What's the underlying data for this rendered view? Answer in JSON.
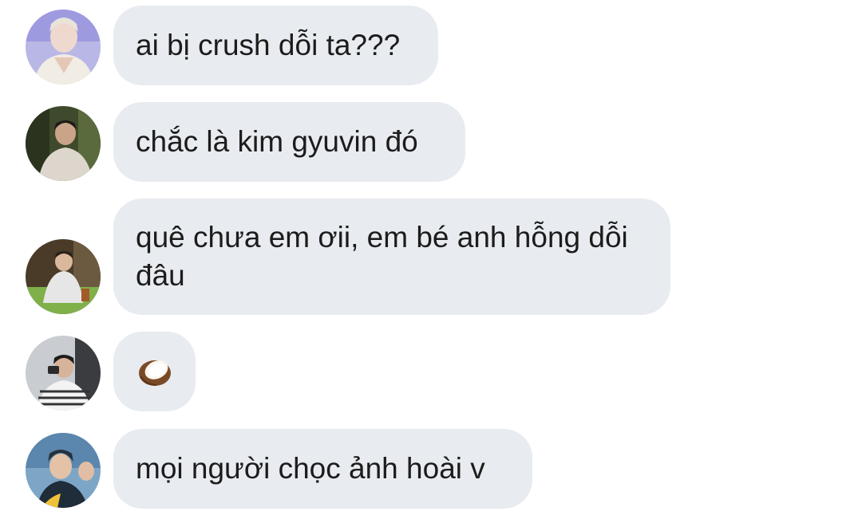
{
  "messages": [
    {
      "avatar": "avatar-1",
      "text": "ai bị crush dỗi ta???"
    },
    {
      "avatar": "avatar-2",
      "text": "chắc là kim gyuvin đó"
    },
    {
      "avatar": "avatar-3",
      "text": "quê chưa em ơii, em bé anh hỗng dỗi đâu"
    },
    {
      "avatar": "avatar-4",
      "icon": "coconut-emoji"
    },
    {
      "avatar": "avatar-5",
      "text": "mọi người chọc ảnh hoài v"
    }
  ],
  "colors": {
    "bubble": "#e8ebef",
    "text": "#1c1c1c",
    "background": "#ffffff"
  }
}
